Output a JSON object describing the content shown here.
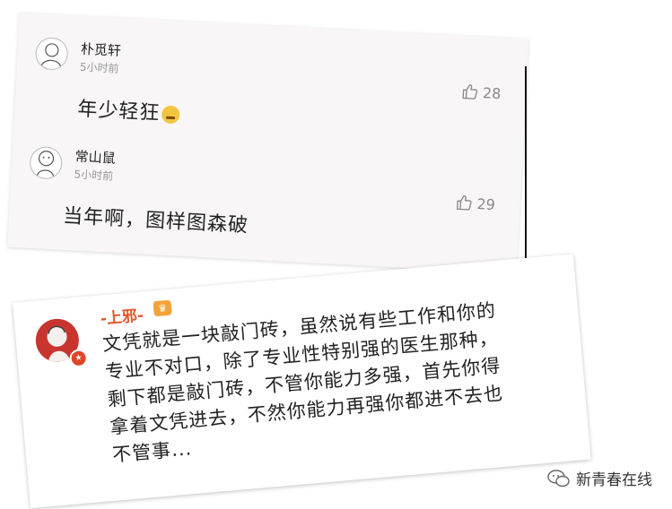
{
  "comments": [
    {
      "user": "朴觅轩",
      "time": "5小时前",
      "likes": "28",
      "text": "年少轻狂"
    },
    {
      "user": "常山鼠",
      "time": "5小时前",
      "likes": "29",
      "text": "当年啊，图样图森破"
    }
  ],
  "featured_comment": {
    "user": "-上邪-",
    "text": "文凭就是一块敲门砖，虽然说有些工作和你的专业不对口，除了专业性特别强的医生那种，剩下都是敲门砖，不管你能力多强，首先你得拿着文凭进去，不然你能力再强你都进不去也不管事..."
  },
  "watermark": {
    "text": "新青春在线"
  },
  "icons": {
    "like": "thumbs-up-icon",
    "emoji": "laughing-emoji-icon",
    "crown": "crown-icon",
    "watermark": "wechat-icon"
  },
  "colors": {
    "username_accent": "#e5552a",
    "avatar_red": "#c8352f"
  }
}
